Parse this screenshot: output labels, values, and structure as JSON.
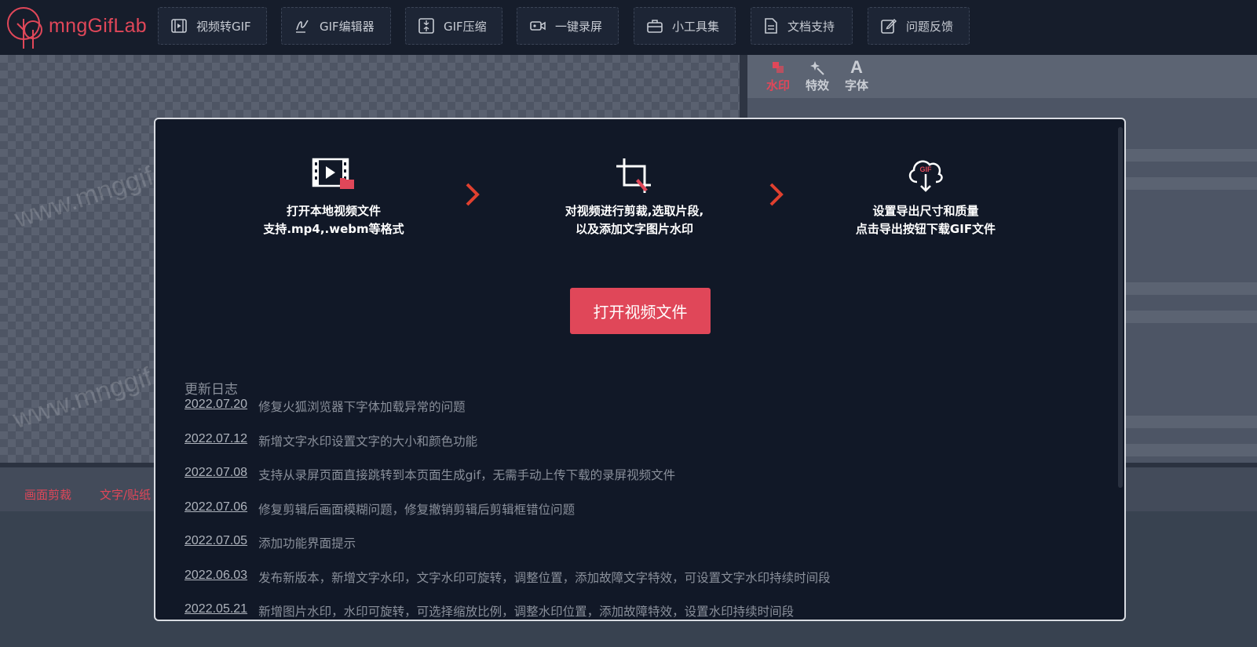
{
  "app": {
    "logo_text": "mngGifLab",
    "accent": "#e04759"
  },
  "nav": [
    {
      "label": "视频转GIF",
      "icon": "film-icon"
    },
    {
      "label": "GIF编辑器",
      "icon": "signature-icon"
    },
    {
      "label": "GIF压缩",
      "icon": "compress-icon"
    },
    {
      "label": "一键录屏",
      "icon": "video-camera-icon"
    },
    {
      "label": "小工具集",
      "icon": "toolbox-icon"
    },
    {
      "label": "文档支持",
      "icon": "document-icon"
    },
    {
      "label": "问题反馈",
      "icon": "feedback-icon"
    }
  ],
  "canvas": {
    "watermark_1": "www.mnggif",
    "watermark_2": "www.mnggif"
  },
  "right_panel": {
    "tabs": [
      {
        "label": "水印",
        "icon": "watermark-icon"
      },
      {
        "label": "特效",
        "icon": "magic-wand-icon"
      },
      {
        "label": "字体",
        "icon": "font-icon"
      }
    ],
    "active_tab": "水印"
  },
  "bottom_bar": {
    "items": [
      "画面剪裁",
      "文字/贴纸"
    ]
  },
  "modal": {
    "steps": [
      {
        "line1": "打开本地视频文件",
        "line2": "支持.mp4,.webm等格式",
        "icon": "film-folder-icon"
      },
      {
        "line1": "对视频进行剪裁,选取片段,",
        "line2": "以及添加文字图片水印",
        "icon": "crop-icon"
      },
      {
        "line1": "设置导出尺寸和质量",
        "line2": "点击导出按钮下载GIF文件",
        "icon": "gif-download-icon"
      }
    ],
    "open_button": "打开视频文件",
    "changelog_title": "更新日志",
    "changelog": [
      {
        "date": "2022.07.20",
        "text": "修复火狐浏览器下字体加载异常的问题"
      },
      {
        "date": "2022.07.12",
        "text": "新增文字水印设置文字的大小和颜色功能"
      },
      {
        "date": "2022.07.08",
        "text": "支持从录屏页面直接跳转到本页面生成gif，无需手动上传下载的录屏视频文件"
      },
      {
        "date": "2022.07.06",
        "text": "修复剪辑后画面模糊问题，修复撤销剪辑后剪辑框错位问题"
      },
      {
        "date": "2022.07.05",
        "text": "添加功能界面提示"
      },
      {
        "date": "2022.06.03",
        "text": "发布新版本，新增文字水印，文字水印可旋转，调整位置，添加故障文字特效，可设置文字水印持续时间段"
      },
      {
        "date": "2022.05.21",
        "text": "新增图片水印，水印可旋转，可选择缩放比例，调整水印位置，添加故障特效，设置水印持续时间段"
      }
    ]
  }
}
